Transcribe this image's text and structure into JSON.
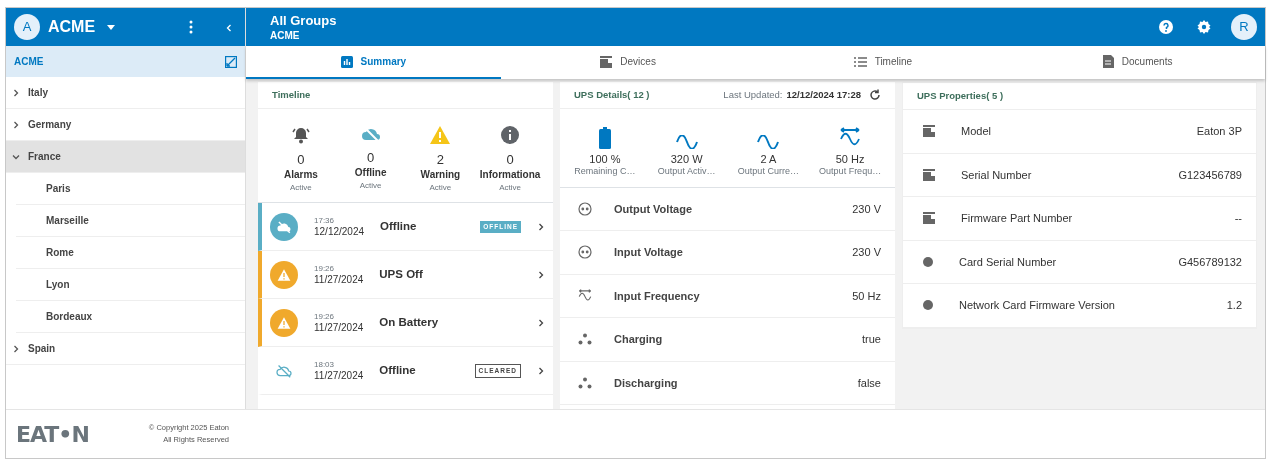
{
  "sidebar_header": {
    "avatar": "A",
    "title": "ACME"
  },
  "sidebar": {
    "root": {
      "label": "ACME",
      "selected": true
    },
    "items": [
      {
        "label": "Italy",
        "expanded": false,
        "selected": false
      },
      {
        "label": "Germany",
        "expanded": false,
        "selected": false
      },
      {
        "label": "France",
        "expanded": true,
        "selected": true,
        "children": [
          {
            "label": "Paris",
            "selected": false
          },
          {
            "label": "Marseille",
            "selected": false
          },
          {
            "label": "Rome",
            "selected": false
          },
          {
            "label": "Lyon",
            "selected": false
          },
          {
            "label": "Bordeaux",
            "selected": false
          }
        ]
      },
      {
        "label": "Spain",
        "expanded": false,
        "selected": false
      }
    ]
  },
  "header": {
    "title": "All Groups",
    "subtitle": "ACME",
    "avatar": "R"
  },
  "tabs": [
    {
      "label": "Summary",
      "kind": "chart",
      "selected": true
    },
    {
      "label": "Devices",
      "kind": "device",
      "selected": false
    },
    {
      "label": "Timeline",
      "kind": "list",
      "selected": false
    },
    {
      "label": "Documents",
      "kind": "document",
      "selected": false
    }
  ],
  "timeline": {
    "title": "Timeline",
    "stats": [
      {
        "kind": "alarm",
        "count": "0",
        "label": "Alarms",
        "sub": "Active"
      },
      {
        "kind": "offline",
        "count": "0",
        "label": "Offline",
        "sub": "Active"
      },
      {
        "kind": "warning",
        "count": "2",
        "label": "Warning",
        "sub": "Active"
      },
      {
        "kind": "info",
        "count": "0",
        "label": "Informationa",
        "sub": "Active"
      }
    ],
    "events": [
      {
        "kind": "offline",
        "active": true,
        "time": "17:36",
        "date": "12/12/2024",
        "title": "Offline",
        "badge": "OFFLINE"
      },
      {
        "kind": "warning",
        "active": true,
        "time": "19:26",
        "date": "11/27/2024",
        "title": "UPS Off"
      },
      {
        "kind": "warning",
        "active": true,
        "time": "19:26",
        "date": "11/27/2024",
        "title": "On Battery"
      },
      {
        "kind": "offline",
        "active": false,
        "time": "18:03",
        "date": "11/27/2024",
        "title": "Offline",
        "badge": "CLEARED"
      }
    ]
  },
  "ups_details": {
    "title": "UPS Details( 12 )",
    "updated_label": "Last Updated:",
    "updated_value": "12/12/2024 17:28",
    "metrics": [
      {
        "kind": "battery",
        "value": "100 %",
        "label": "Remaining C…"
      },
      {
        "kind": "sine",
        "value": "320 W",
        "label": "Output Activ…"
      },
      {
        "kind": "sine",
        "value": "2 A",
        "label": "Output Curre…"
      },
      {
        "kind": "frequency",
        "value": "50 Hz",
        "label": "Output Frequ…"
      }
    ],
    "rows": [
      {
        "kind": "plug",
        "label": "Output Voltage",
        "value": "230 V"
      },
      {
        "kind": "plug",
        "label": "Input Voltage",
        "value": "230 V"
      },
      {
        "kind": "frequency",
        "label": "Input Frequency",
        "value": "50 Hz"
      },
      {
        "kind": "dots",
        "label": "Charging",
        "value": "true"
      },
      {
        "kind": "dots",
        "label": "Discharging",
        "value": "false"
      }
    ]
  },
  "ups_properties": {
    "title": "UPS Properties( 5 )",
    "rows": [
      {
        "kind": "device",
        "label": "Model",
        "value": "Eaton 3P"
      },
      {
        "kind": "device",
        "label": "Serial Number",
        "value": "G123456789"
      },
      {
        "kind": "device",
        "label": "Firmware Part Number",
        "value": "--"
      },
      {
        "kind": "dot",
        "label": "Card Serial Number",
        "value": "G456789132"
      },
      {
        "kind": "dot",
        "label": "Network Card Firmware Version",
        "value": "1.2"
      }
    ]
  },
  "footer": {
    "logo": "EAT•N",
    "copyright": "© Copyright 2025 Eaton",
    "rights": "All Rights Reserved"
  }
}
